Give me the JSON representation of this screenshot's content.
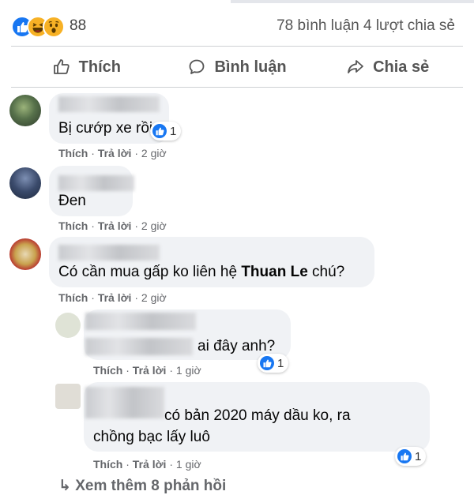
{
  "summary": {
    "reaction_icons": [
      "like-icon",
      "haha-icon",
      "wow-icon"
    ],
    "reaction_count": "88",
    "comments_shares": "78 bình luận  4 lượt chia sẻ"
  },
  "actions": {
    "like": "Thích",
    "comment": "Bình luận",
    "share": "Chia sẻ"
  },
  "comments": [
    {
      "text": "Bị cướp xe rồi",
      "reactions": "1",
      "like": "Thích",
      "reply": "Trả lời",
      "time": "2 giờ"
    },
    {
      "text": "Đen",
      "like": "Thích",
      "reply": "Trả lời",
      "time": "2 giờ"
    },
    {
      "text_before": "Có cần mua gấp ko liên hệ ",
      "mention": "Thuan Le",
      "text_after": " chú?",
      "like": "Thích",
      "reply": "Trả lời",
      "time": "2 giờ"
    }
  ],
  "replies": [
    {
      "text": "ai đây anh?",
      "reactions": "1",
      "like": "Thích",
      "reply": "Trả lời",
      "time": "1 giờ"
    },
    {
      "line1": "có bản 2020 máy dầu ko, ra",
      "line2": "chồng bạc lấy luô",
      "reactions": "1",
      "like": "Thích",
      "reply": "Trả lời",
      "time": "1 giờ"
    }
  ],
  "more_replies": "↳ Xem thêm 8 phản hồi",
  "colors": {
    "like_blue": "#1877f2",
    "bubble_bg": "#f0f2f5",
    "meta_grey": "#65676b"
  }
}
